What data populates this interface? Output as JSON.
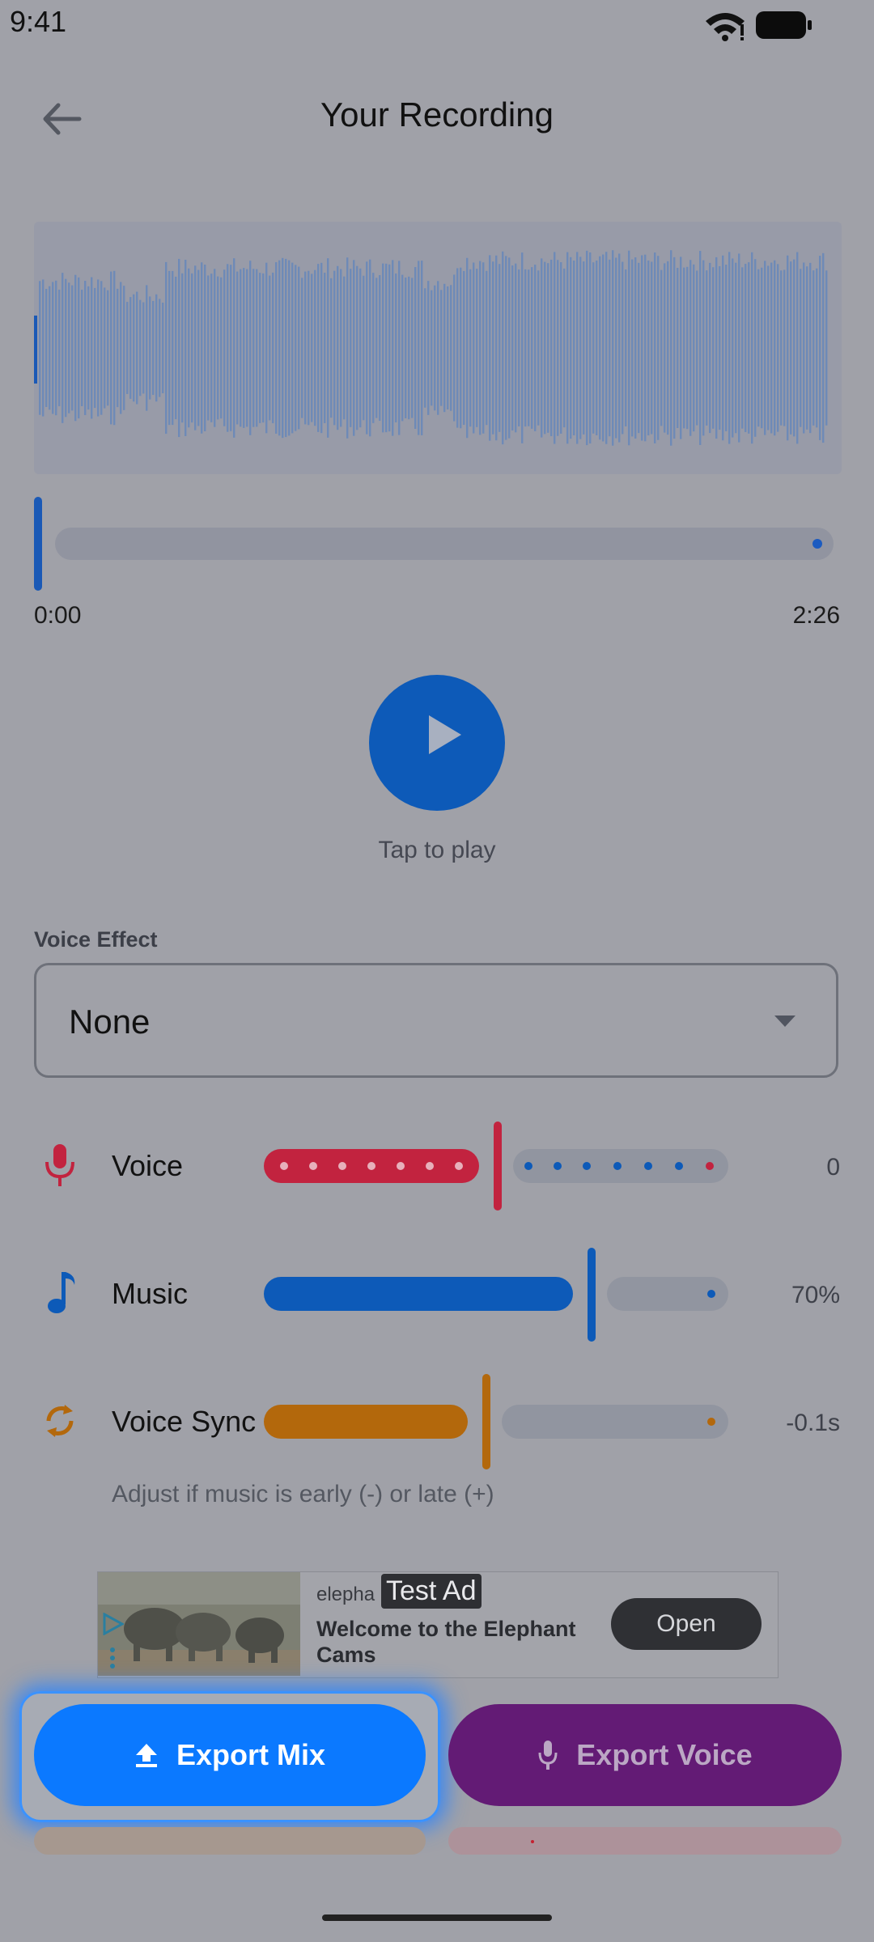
{
  "status_bar": {
    "time": "9:41",
    "wifi_icon": "wifi-icon",
    "battery_icon": "battery-icon"
  },
  "header": {
    "title": "Your Recording",
    "back_icon": "arrow-left-icon"
  },
  "player": {
    "current_time": "0:00",
    "duration": "2:26",
    "progress": 0.0,
    "play_hint": "Tap to play",
    "play_icon": "play-icon"
  },
  "voice_effect": {
    "label": "Voice Effect",
    "value": "None",
    "caret_icon": "caret-down-icon"
  },
  "sliders": [
    {
      "key": "voice",
      "label": "Voice",
      "value": "0",
      "icon": "microphone-icon",
      "color": "#c2233f",
      "level": 0.5
    },
    {
      "key": "music",
      "label": "Music",
      "value": "70%",
      "icon": "music-note-icon",
      "color": "#0d5ab8",
      "level": 0.7
    },
    {
      "key": "sync",
      "label": "Voice Sync",
      "value": "-0.1s",
      "icon": "sync-icon",
      "color": "#b3680c",
      "level": 0.45
    }
  ],
  "sync_hint": "Adjust if music is early (-) or late (+)",
  "ad": {
    "brand": "elepha",
    "badge": "Test Ad",
    "headline": "Welcome to the Elephant Cams",
    "cta": "Open"
  },
  "actions": {
    "export_mix": "Export Mix",
    "export_voice": "Export Voice"
  },
  "colors": {
    "accent_blue": "#0b79ff",
    "voice_purple": "#631b75",
    "waveform": "#6e8ab7"
  }
}
